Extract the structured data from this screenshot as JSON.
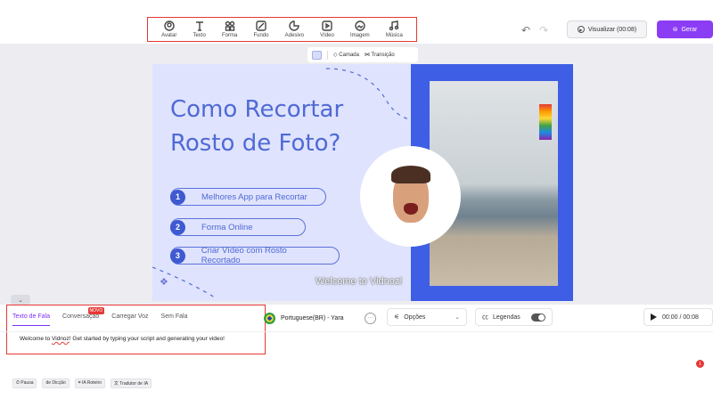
{
  "toolbar": {
    "tools": [
      {
        "label": "Avatar",
        "icon": "avatar-icon"
      },
      {
        "label": "Texto",
        "icon": "text-icon"
      },
      {
        "label": "Forma",
        "icon": "shapes-icon"
      },
      {
        "label": "Fundo",
        "icon": "background-icon"
      },
      {
        "label": "Adesivo",
        "icon": "sticker-icon"
      },
      {
        "label": "Vídeo",
        "icon": "video-icon"
      },
      {
        "label": "Imagem",
        "icon": "image-icon"
      },
      {
        "label": "Música",
        "icon": "music-icon"
      }
    ],
    "preview_label": "Visualizar (00:08)",
    "generate_label": "Gerar",
    "accent_color": "#8b3df5"
  },
  "layer_bar": {
    "layer_label": "Camada",
    "transition_label": "Transição"
  },
  "canvas": {
    "title_line1": "Como Recortar",
    "title_line2": "Rosto de Foto?",
    "items": [
      {
        "num": "1",
        "label": "Melhores App para Recortar"
      },
      {
        "num": "2",
        "label": "Forma Online"
      },
      {
        "num": "3",
        "label": "Criar Vídeo com Rosto Recortado"
      }
    ],
    "watermark": "Welcome to Vidnoz!",
    "background_color": "#dfe3fd",
    "panel_color": "#3f5ee6"
  },
  "bottom": {
    "tabs": [
      {
        "label": "Texto de Fala"
      },
      {
        "label": "Conversação"
      },
      {
        "label": "Carregar Voz"
      },
      {
        "label": "Sem Fala"
      }
    ],
    "new_badge": "NOVO",
    "voice_label": "Portuguese(BR) - Yara",
    "options_label": "Opções",
    "subtitles_label": "Legendas",
    "player_time": "00:00 / 00:08",
    "script_prefix": "Welcome to ",
    "script_brand": "Vidnoz",
    "script_suffix": "! Get started by typing your script and generating your video!",
    "notification_count": "1",
    "footer_buttons": [
      {
        "label": "Pausa"
      },
      {
        "label": "de Dicção"
      },
      {
        "label": "IA Roteiro"
      },
      {
        "label": "Tradutor de IA"
      }
    ]
  }
}
